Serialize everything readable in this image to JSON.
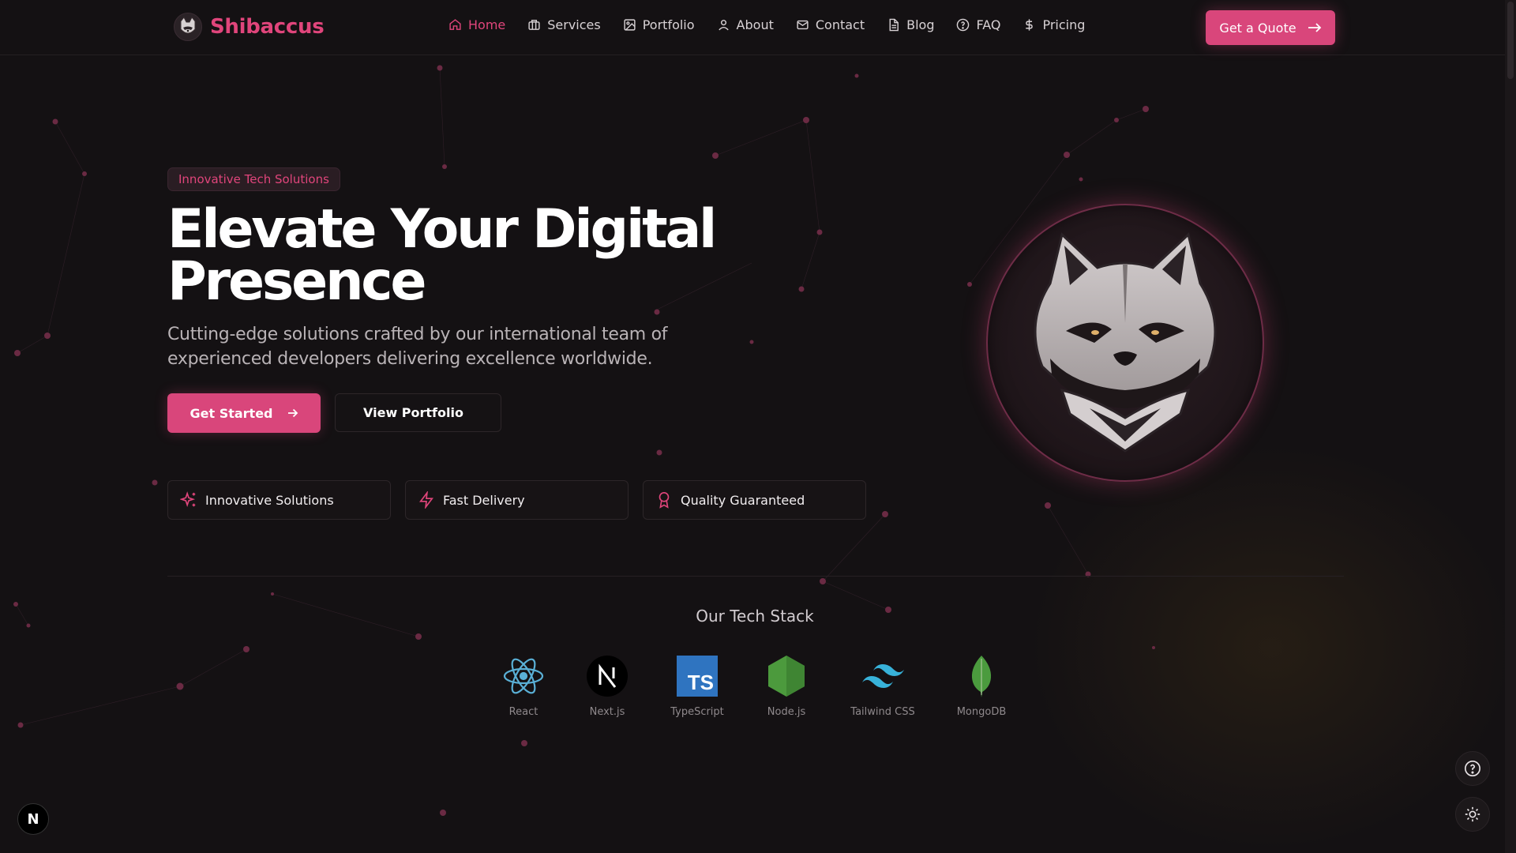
{
  "brand": {
    "name": "Shibaccus",
    "logo_icon": "shiba-logo-icon"
  },
  "nav": {
    "items": [
      {
        "label": "Home",
        "icon": "home-icon",
        "active": true
      },
      {
        "label": "Services",
        "icon": "briefcase-icon"
      },
      {
        "label": "Portfolio",
        "icon": "image-icon"
      },
      {
        "label": "About",
        "icon": "user-icon"
      },
      {
        "label": "Contact",
        "icon": "mail-icon"
      },
      {
        "label": "Blog",
        "icon": "file-icon"
      },
      {
        "label": "FAQ",
        "icon": "help-circle-icon"
      },
      {
        "label": "Pricing",
        "icon": "dollar-icon"
      }
    ],
    "cta_label": "Get a Quote"
  },
  "hero": {
    "badge": "Innovative Tech Solutions",
    "title": "Elevate Your Digital Presence",
    "subtitle": "Cutting-edge solutions crafted by our international team of experienced developers delivering excellence worldwide.",
    "primary_label": "Get Started",
    "secondary_label": "View Portfolio",
    "features": [
      {
        "label": "Innovative Solutions",
        "icon": "sparkles-icon"
      },
      {
        "label": "Fast Delivery",
        "icon": "lightning-icon"
      },
      {
        "label": "Quality Guaranteed",
        "icon": "award-icon"
      }
    ]
  },
  "tech_stack": {
    "title": "Our Tech Stack",
    "items": [
      "React",
      "Next.js",
      "TypeScript",
      "Node.js",
      "Tailwind CSS",
      "MongoDB"
    ],
    "typescript_badge": "TS"
  },
  "floating": {
    "help_icon": "help-circle-icon",
    "theme_icon": "sun-icon",
    "next_badge": "N"
  },
  "colors": {
    "accent": "#d9467b",
    "background": "#141113",
    "text": "#ffffff"
  }
}
